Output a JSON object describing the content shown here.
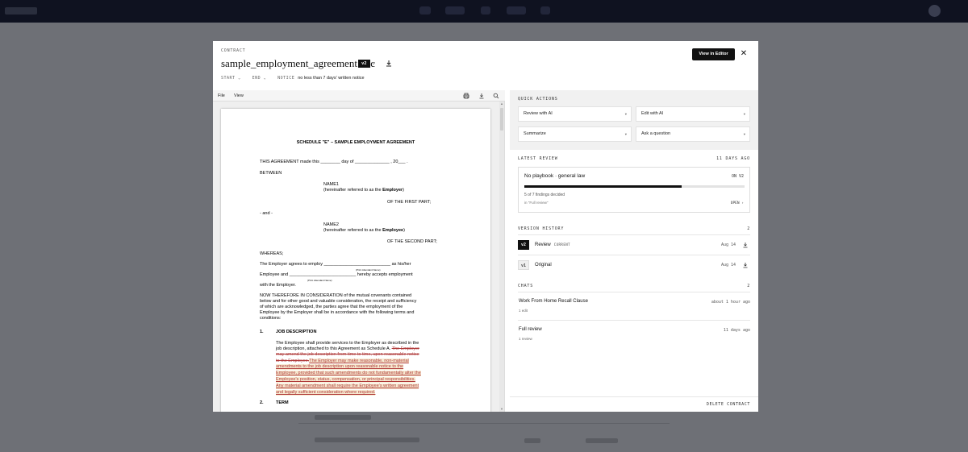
{
  "modal": {
    "eyebrow": "CONTRACT",
    "filename": "sample_employment_agreement.doc",
    "version_badge": "v2",
    "meta": {
      "start_label": "START",
      "end_label": "END",
      "notice_label": "NOTICE",
      "notice_value": "no less than 7 days' written notice"
    },
    "view_in_editor": "View in Editor",
    "close": "✕"
  },
  "viewer": {
    "menu": [
      "File",
      "View"
    ],
    "document": {
      "title": "SCHEDULE \"E\" – SAMPLE EMPLOYMENT AGREEMENT",
      "made_this": "THIS AGREEMENT made this ________ day of  ______________  , 20___ .",
      "between": "BETWEEN",
      "name1": "NAME1",
      "name1_ref_prefix": "(hereinafter referred to as the ",
      "employer": "Employer",
      "close_paren": ")",
      "first_part": "OF THE FIRST PART;",
      "and": "- and -",
      "name2": "NAME2",
      "name2_ref_prefix": "(hereinafter referred to as the ",
      "employee": "Employee",
      "second_part": "OF THE SECOND PART;",
      "whereas": "WHEREAS;",
      "agrees_line": "The Employer agrees to employ ___________________________ as his/her",
      "print_name_1": "(Print Attendant Name)",
      "employee_and_line": "Employee and ___________________________ hereby accepts employment",
      "print_name_2": "(Print Attendant Name)",
      "with_employer": "with the Employer.",
      "now_therefore": [
        "NOW THEREFORE IN CONSIDERATION of the mutual covenants contained",
        "below and for other good and valuable consideration, the receipt and sufficiency",
        "of which are acknowledged, the parties agree that the employment of the",
        "Employee by the Employer shall be in accordance with the following terms and",
        "conditions:"
      ],
      "s1_num": "1.",
      "s1_title": "JOB DESCRIPTION",
      "s1_line1": "The Employee shall provide services to the Employer as described in the",
      "s1_line2_plain": "job description, attached to this Agreement as Schedule A.  ",
      "s1_line2_strike": "The Employer",
      "s1_line3_strike": "may amend the job description from time to time, upon reasonable notice",
      "s1_line4_strike": "to the Employee.",
      "s1_line4_ins": "The Employer may make reasonable, non-material",
      "s1_ins_lines": [
        "amendments to the job description upon reasonable notice to the",
        "Employee, provided that such amendments do not fundamentally alter the",
        "Employee's position, status, compensation, or principal responsibilities.",
        "Any material amendment shall require the Employee's written agreement",
        "and legally sufficient consideration where required."
      ],
      "s2_num": "2.",
      "s2_title": "TERM"
    }
  },
  "panel": {
    "quick_actions": {
      "heading": "QUICK ACTIONS",
      "buttons": [
        "Review with AI",
        "Edit with AI",
        "Summarize",
        "Ask a question"
      ]
    },
    "latest_review": {
      "heading": "LATEST REVIEW",
      "when": "11 DAYS AGO",
      "title": "No playbook · general law",
      "version": "ON V2",
      "progress": 0.714,
      "findings": "5 of 7 findings decided",
      "in_label": "in \"Full review\"",
      "open": "OPEN ›"
    },
    "version_history": {
      "heading": "VERSION HISTORY",
      "count": "2",
      "items": [
        {
          "badge": "v2",
          "label": "Review",
          "tag": "CURRENT",
          "date": "Aug 14"
        },
        {
          "badge": "v1",
          "label": "Original",
          "tag": "",
          "date": "Aug 14"
        }
      ]
    },
    "chats": {
      "heading": "CHATS",
      "count": "2",
      "items": [
        {
          "title": "Work From Home Recall Clause",
          "sub": "1 edit",
          "date": "about 1 hour ago"
        },
        {
          "title": "Full review",
          "sub": "1 review",
          "date": "11 days ago"
        }
      ]
    },
    "delete": "DELETE CONTRACT"
  },
  "colors": {
    "accent": "#111111",
    "redline": "#b03a3a",
    "insert_bg": "#f7ead1"
  }
}
